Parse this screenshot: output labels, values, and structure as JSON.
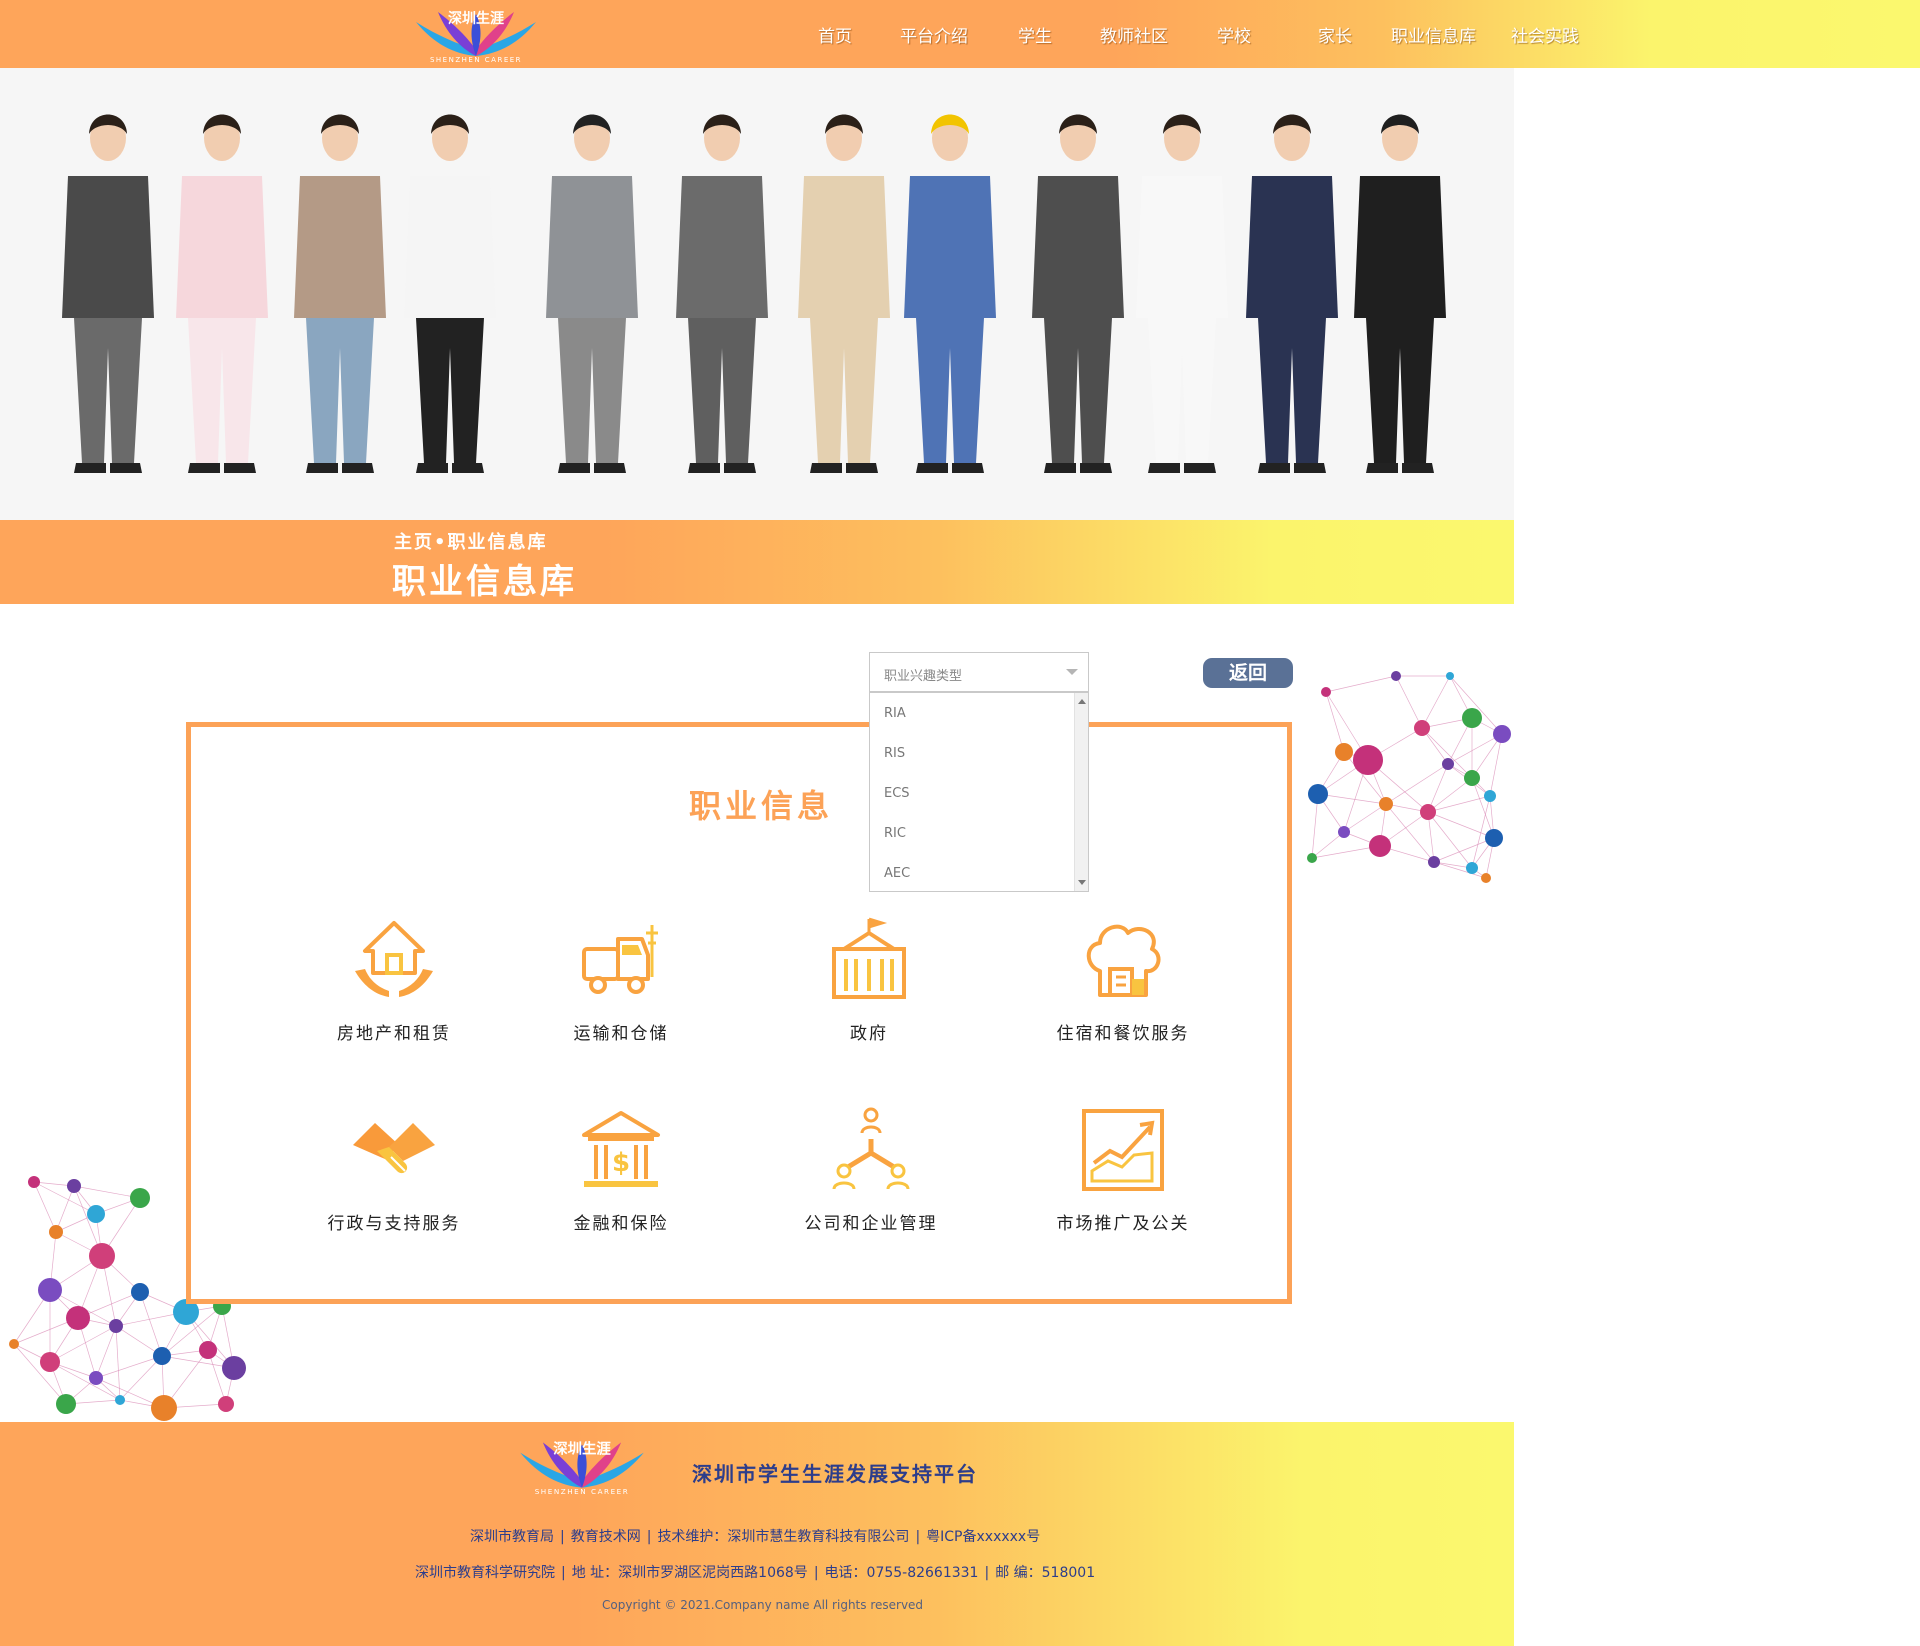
{
  "nav": {
    "logo_text": "深圳生涯",
    "logo_sub": "SHENZHEN CAREER",
    "items": [
      "首页",
      "平台介绍",
      "学生",
      "教师社区",
      "学校",
      "家长",
      "职业信息库",
      "社会实践"
    ]
  },
  "band": {
    "breadcrumb": "主页•职业信息库",
    "title": "职业信息库"
  },
  "back_label": "返回",
  "select": {
    "placeholder": "职业兴趣类型",
    "options": [
      "RIA",
      "RIS",
      "ECS",
      "RIC",
      "AEC"
    ]
  },
  "panel": {
    "title": "职业信息",
    "categories": [
      {
        "label": "房地产和租赁",
        "icon": "house-hands-icon"
      },
      {
        "label": "运输和仓储",
        "icon": "truck-icon"
      },
      {
        "label": "政府",
        "icon": "government-building-icon"
      },
      {
        "label": "住宿和餐饮服务",
        "icon": "chef-hat-icon"
      },
      {
        "label": "行政与支持服务",
        "icon": "handshake-icon"
      },
      {
        "label": "金融和保险",
        "icon": "bank-icon"
      },
      {
        "label": "公司和企业管理",
        "icon": "org-structure-icon"
      },
      {
        "label": "市场推广及公关",
        "icon": "growth-chart-icon"
      }
    ]
  },
  "footer": {
    "logo_text": "深圳生涯",
    "logo_sub": "SHENZHEN CAREER",
    "title": "深圳市学生生涯发展支持平台",
    "row1": [
      "深圳市教育局",
      "教育技术网",
      "技术维护：深圳市慧生教育科技有限公司",
      "粤ICP备xxxxxx号"
    ],
    "row2": [
      "深圳市教育科学研究院",
      "地  址：深圳市罗湖区泥岗西路1068号",
      "电话：0755-82661331",
      "邮  编：518001"
    ],
    "copyright": "Copyright © 2021.Company name All rights reserved"
  },
  "colors": {
    "orange": "#fea55a",
    "yellow": "#fbf86e",
    "panel_border": "#fca257",
    "footer_text": "#2d3d8b",
    "back_button": "#5a7196"
  }
}
